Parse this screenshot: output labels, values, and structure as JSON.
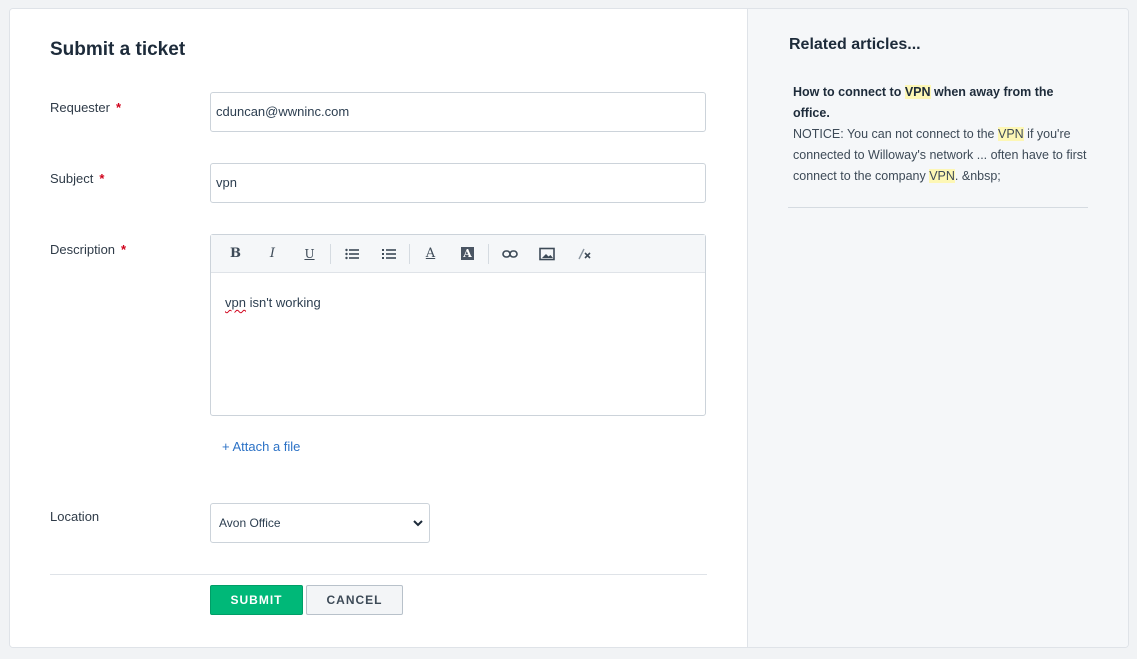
{
  "form": {
    "title": "Submit a ticket",
    "requester": {
      "label": "Requester",
      "required_mark": "*",
      "value": "cduncan@wwninc.com"
    },
    "subject": {
      "label": "Subject",
      "required_mark": "*",
      "value": "vpn"
    },
    "description": {
      "label": "Description",
      "required_mark": "*",
      "text_misspelled": "vpn",
      "text_rest": " isn't working",
      "toolbar": {
        "bold": "B",
        "italic": "I",
        "underline": "U",
        "font_color": "A",
        "bg_color": "A"
      }
    },
    "attach_label": "+ Attach a file",
    "location": {
      "label": "Location",
      "selected": "Avon Office"
    },
    "submit_label": "SUBMIT",
    "cancel_label": "CANCEL"
  },
  "related": {
    "title": "Related articles...",
    "article": {
      "title_pre": "How to connect to ",
      "title_hl": "VPN",
      "title_post": " when away from the office.",
      "excerpt_1": "NOTICE: You can not connect to the ",
      "excerpt_hl1": "VPN",
      "excerpt_2": " if you're connected to Willoway's network ... often have to first connect to the company ",
      "excerpt_hl2": "VPN",
      "excerpt_3": ". &nbsp;"
    }
  },
  "colors": {
    "submit_bg": "#00b878",
    "link": "#2c72c6",
    "required": "#d0021b",
    "highlight": "#fdf7b5"
  }
}
